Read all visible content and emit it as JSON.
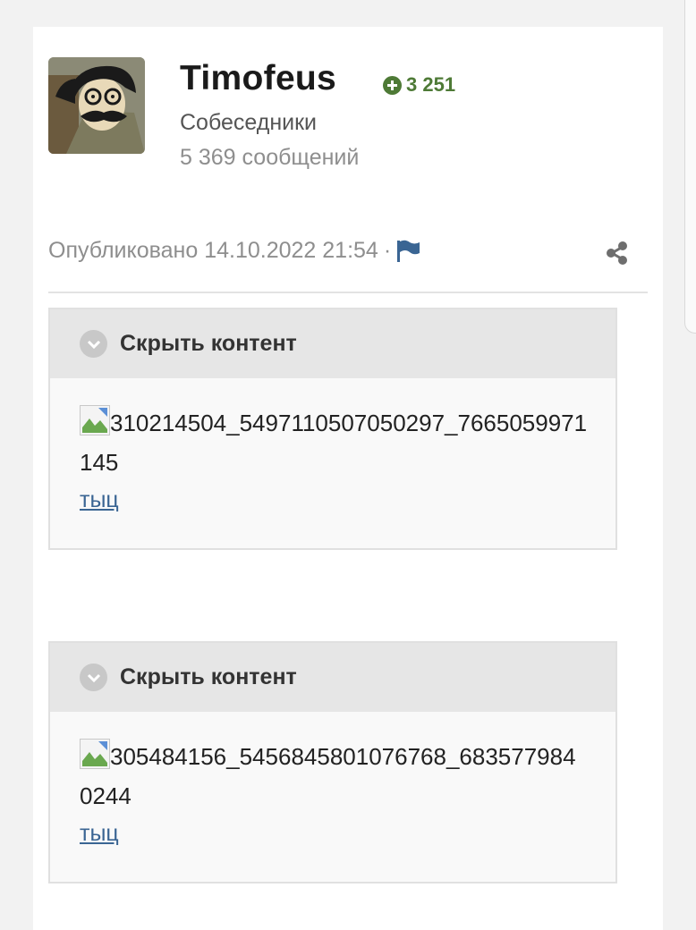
{
  "author": {
    "name": "Timofeus",
    "reputation": "3 251",
    "group": "Собеседники",
    "post_count": "5 369 сообщений"
  },
  "post": {
    "published": "Опубликовано 14.10.2022 21:54",
    "separator": "·"
  },
  "spoilers": [
    {
      "header": "Скрыть контент",
      "image_alt": "310214504_5497110507050297_7665059971145",
      "link_text": "тыц"
    },
    {
      "header": "Скрыть контент",
      "image_alt": "305484156_5456845801076768_6835779840244",
      "link_text": "тыц"
    }
  ],
  "colors": {
    "reputation": "#4e7a36",
    "link": "#3a6593",
    "flag": "#3a6593"
  },
  "icons": [
    "reputation-plus-icon",
    "report-flag-icon",
    "share-icon",
    "chevron-down-icon",
    "broken-image-icon"
  ]
}
